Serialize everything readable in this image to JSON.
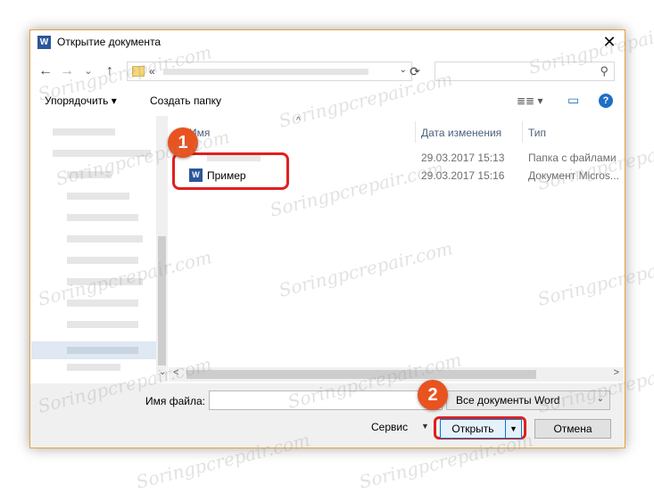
{
  "window": {
    "title": "Открытие документа",
    "close_glyph": "✕",
    "app_icon": "W"
  },
  "nav": {
    "back": "←",
    "forward": "→",
    "dropdown": "⌄",
    "up": "↑",
    "refresh": "⟳",
    "search_icon": "⚲",
    "address_dropdown": "⌄"
  },
  "address": {
    "separator": "«"
  },
  "toolbar": {
    "organize": "Упорядочить ▾",
    "new_folder": "Создать папку",
    "view_icon": "≣≣ ▾",
    "pane_icon": "▭",
    "help": "?"
  },
  "columns": {
    "name": "Имя",
    "date": "Дата изменения",
    "type": "Тип",
    "sort_caret": "^"
  },
  "files": [
    {
      "name": "",
      "date": "29.03.2017 15:13",
      "type": "Папка с файлами"
    },
    {
      "name": "Пример",
      "date": "29.03.2017 15:16",
      "type": "Документ Micros...",
      "icon": "W"
    }
  ],
  "scroll": {
    "left": "<",
    "right": ">",
    "down": "⌄"
  },
  "bottom": {
    "filename_label": "Имя файла:",
    "filename_value": "",
    "filetype": "Все документы Word",
    "filetype_arrow": "⌄",
    "service": "Сервис",
    "service_arrow": "▼",
    "open": "Открыть",
    "open_dd": "▼",
    "cancel": "Отмена"
  },
  "annotations": {
    "badge1": "1",
    "badge2": "2"
  },
  "watermark": "Soringpcrepair.com",
  "colors": {
    "accent": "#0078d7",
    "highlight": "#e0201f",
    "badge": "#e8531f",
    "word": "#2b579a"
  }
}
